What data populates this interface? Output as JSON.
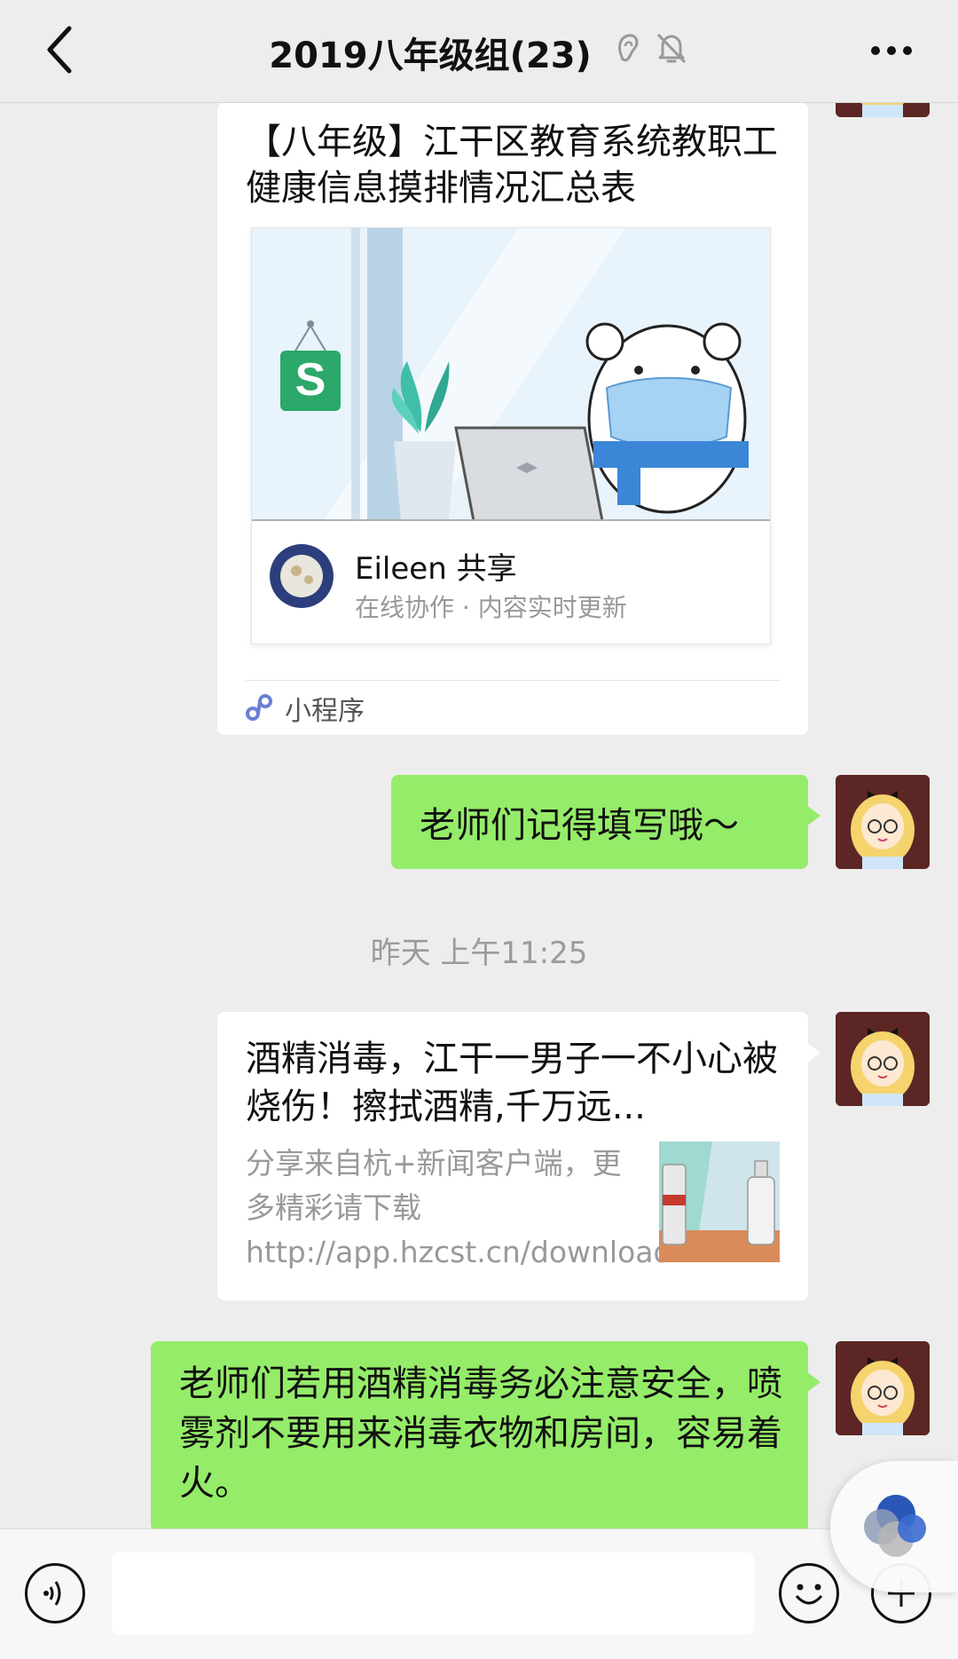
{
  "header": {
    "title": "2019八年级组(23)",
    "back_icon": "chevron-left-icon",
    "more_icon": "more-dots-icon",
    "status_icons": [
      "ear-icon",
      "mute-bell-icon"
    ]
  },
  "messages": {
    "mini_program": {
      "title": "【八年级】江干区教育系统教职工健康信息摸排情况汇总表",
      "sharer": "Eileen 共享",
      "subtitle": "在线协作 · 内容实时更新",
      "footer_label": "小程序"
    },
    "reminder_text": "老师们记得填写哦～",
    "timestamp": "昨天 上午11:25",
    "link_card": {
      "title": "酒精消毒，江干一男子一不小心被烧伤！擦拭酒精,千万远...",
      "desc": "分享来自杭+新闻客户端，更多精彩请下载 http://app.hzcst.cn/download..."
    },
    "warning_text": "老师们若用酒精消毒务必注意安全，喷雾剂不要用来消毒衣物和房间，容易着火。"
  },
  "input_bar": {
    "voice_icon": "voice-icon",
    "emoji_icon": "emoji-icon",
    "plus_icon": "plus-icon",
    "text_value": ""
  },
  "colors": {
    "background": "#ededed",
    "sent_bubble": "#95ec69",
    "card": "#ffffff",
    "wps_green": "#2ba86a"
  }
}
